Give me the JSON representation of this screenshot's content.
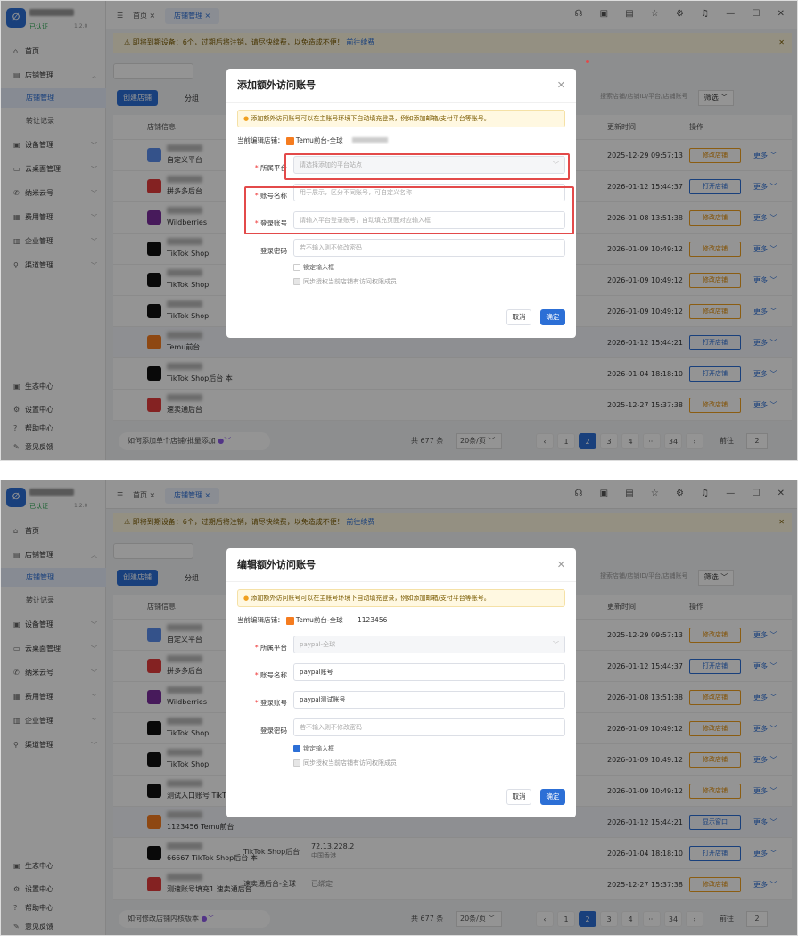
{
  "app": {
    "version": "1.2.0",
    "user_status": "已认证",
    "tabs": [
      "首页",
      "店铺管理"
    ],
    "notice": "即将到期设备：6个，过期后将注销，请尽快续费，以免造成不便！",
    "notice_link": "前往续费",
    "sidebar": {
      "items": [
        "首页",
        "店铺管理",
        "店铺管理",
        "转让记录",
        "设备管理",
        "云桌面管理",
        "纳米云号",
        "费用管理",
        "企业管理",
        "渠道管理"
      ],
      "bottom": [
        "生态中心",
        "设置中心",
        "帮助中心",
        "意见反馈"
      ]
    },
    "toolbar": {
      "create": "创建店铺",
      "group": "分组",
      "search_placeholder": "搜索店铺/店铺ID/平台/店铺账号",
      "filter": "筛选"
    },
    "columns": {
      "store": "店铺信息",
      "update": "更新时间",
      "ops": "操作"
    }
  },
  "panel1": {
    "rows": [
      {
        "name": "自定义平台",
        "time": "2025-12-29 09:57:13",
        "op": "修改店铺",
        "opcolor": "orange",
        "more": "更多"
      },
      {
        "name": "拼多多后台",
        "time": "2026-01-12 15:44:37",
        "op": "打开店铺",
        "opcolor": "blue",
        "more": "更多"
      },
      {
        "name": "Wildberries",
        "time": "2026-01-08 13:51:38",
        "op": "修改店铺",
        "opcolor": "orange",
        "more": "更多"
      },
      {
        "name": "TikTok Shop",
        "time": "2026-01-09 10:49:12",
        "op": "修改店铺",
        "opcolor": "orange",
        "more": "更多"
      },
      {
        "name": "TikTok Shop",
        "time": "2026-01-09 10:49:12",
        "op": "修改店铺",
        "opcolor": "orange",
        "more": "更多"
      },
      {
        "name": "TikTok Shop",
        "time": "2026-01-09 10:49:12",
        "op": "修改店铺",
        "opcolor": "orange",
        "more": "更多"
      },
      {
        "name": "Temu前台",
        "time": "2026-01-12 15:44:21",
        "op": "打开店铺",
        "opcolor": "blue",
        "more": "更多"
      },
      {
        "name": "TikTok Shop后台 本",
        "time": "2026-01-04 18:18:10",
        "op": "打开店铺",
        "opcolor": "blue",
        "more": "更多"
      },
      {
        "name": "速卖通后台",
        "time": "2025-12-27 15:37:38",
        "op": "修改店铺",
        "opcolor": "orange",
        "more": "更多"
      }
    ],
    "help": "如何添加单个店铺/批量添加",
    "pager": {
      "total": "共 677 条",
      "size": "20条/页",
      "pages": [
        "1",
        "2",
        "3",
        "4",
        "···",
        "34"
      ],
      "goto": "前往",
      "page": "2"
    },
    "modal": {
      "title": "添加额外访问账号",
      "tip": "添加额外访问账号可以在主账号环境下自动填充登录，例如添加邮箱/支付平台等账号。",
      "current_label": "当前编辑店铺：",
      "store": "Temu前台-全球",
      "platform_label": "所属平台",
      "platform_placeholder": "请选择添加的平台站点",
      "name_label": "账号名称",
      "name_placeholder": "用于展示，区分不同账号，可自定义名称",
      "login_label": "登录账号",
      "login_placeholder": "请输入平台登录账号，自动填充页面对应输入框",
      "pwd_label": "登录密码",
      "pwd_placeholder": "若不输入则不修改密码",
      "lock": "锁定输入框",
      "sync": "同步授权当前店铺有访问权限成员",
      "cancel": "取消",
      "ok": "确定"
    }
  },
  "panel2": {
    "rows": [
      {
        "name": "自定义平台",
        "time": "2025-12-29 09:57:13",
        "op": "修改店铺",
        "opcolor": "orange",
        "more": "更多"
      },
      {
        "name": "拼多多后台",
        "time": "2026-01-12 15:44:37",
        "op": "打开店铺",
        "opcolor": "blue",
        "more": "更多"
      },
      {
        "name": "Wildberries",
        "time": "2026-01-08 13:51:38",
        "op": "修改店铺",
        "opcolor": "orange",
        "more": "更多"
      },
      {
        "name": "TikTok Shop",
        "time": "2026-01-09 10:49:12",
        "op": "修改店铺",
        "opcolor": "orange",
        "more": "更多"
      },
      {
        "name": "TikTok Shop",
        "time": "2026-01-09 10:49:12",
        "op": "修改店铺",
        "opcolor": "orange",
        "more": "更多"
      },
      {
        "name": "测试入口账号 TikTok Shop",
        "time": "2026-01-09 10:49:12",
        "op": "修改店铺",
        "opcolor": "orange",
        "more": "更多"
      },
      {
        "name": "1123456 Temu前台",
        "time": "2026-01-12 15:44:21",
        "op": "显示窗口",
        "opcolor": "blue",
        "more": "更多"
      },
      {
        "name": "66667 TikTok Shop后台 本",
        "time": "2026-01-04 18:18:10",
        "op": "打开店铺",
        "opcolor": "blue",
        "more": "更多"
      },
      {
        "name": "测速账号填充1 速卖通后台",
        "time": "2025-12-27 15:37:38",
        "op": "修改店铺",
        "opcolor": "orange",
        "more": "更多"
      }
    ],
    "extra": {
      "platform": "TikTok Shop后台",
      "ip": "72.13.228.2",
      "region": "中国香港",
      "sm": "速卖通后台-全球",
      "unbound": "已绑定"
    },
    "help": "如何修改店铺内核版本",
    "modal": {
      "title": "编辑额外访问账号",
      "tip": "添加额外访问账号可以在主账号环境下自动填充登录，例如添加邮箱/支付平台等账号。",
      "current_label": "当前编辑店铺：",
      "store": "Temu前台-全球",
      "store_id": "1123456",
      "platform_label": "所属平台",
      "platform_value": "paypal-全球",
      "name_label": "账号名称",
      "name_value": "paypal账号",
      "login_label": "登录账号",
      "login_value": "paypal测试账号",
      "pwd_label": "登录密码",
      "pwd_placeholder": "若不输入则不修改密码",
      "lock": "锁定输入框",
      "sync": "同步授权当前店铺有访问权限成员",
      "cancel": "取消",
      "ok": "确定"
    }
  },
  "colors": {
    "primary": "#2c6fd6",
    "warning": "#f0a020",
    "highlight": "#e34a4a"
  },
  "icons": [
    "logo-icon",
    "home-icon",
    "store-icon",
    "device-icon",
    "desktop-icon",
    "phone-icon",
    "fee-icon",
    "enterprise-icon",
    "channel-icon",
    "headset-icon",
    "gift-icon",
    "star-icon",
    "gear-icon",
    "bell-icon",
    "close-icon"
  ]
}
